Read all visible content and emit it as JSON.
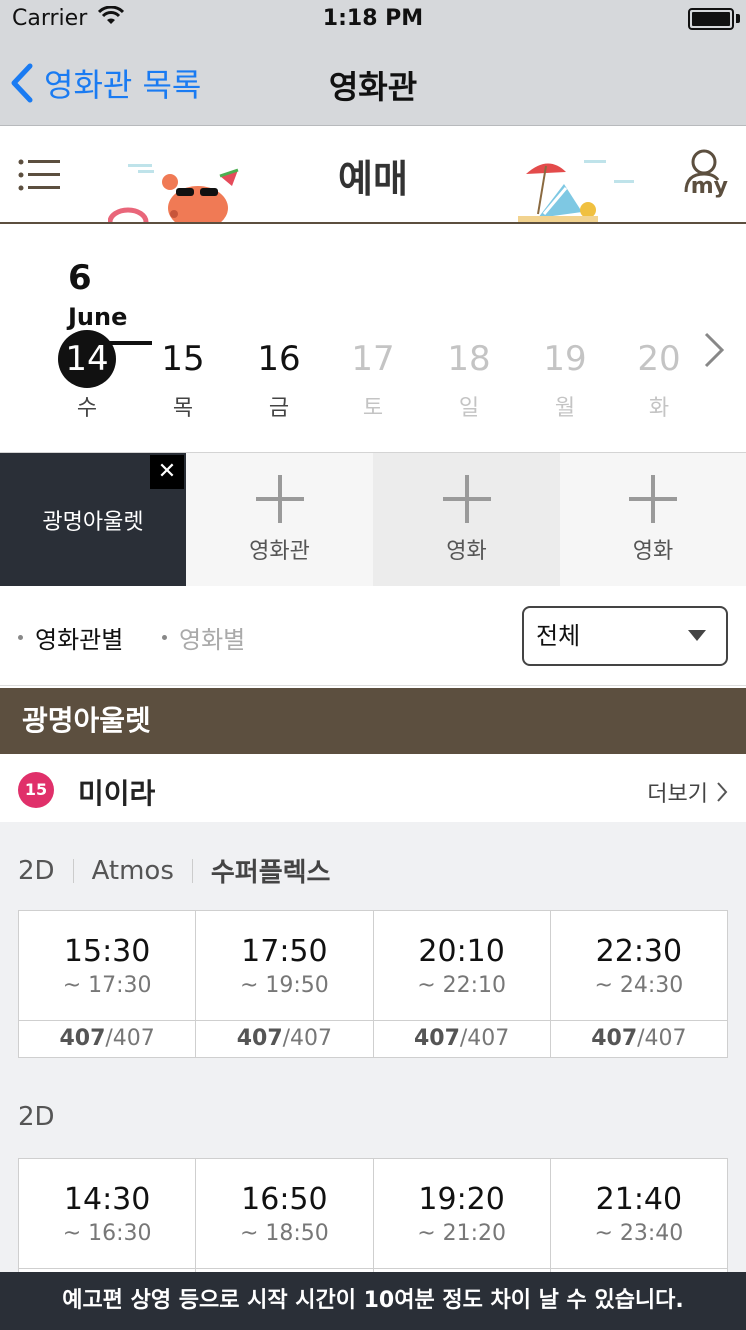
{
  "status_bar": {
    "carrier": "Carrier",
    "time": "1:18 PM"
  },
  "nav": {
    "back_label": "영화관 목록",
    "title": "영화관"
  },
  "booking_header": {
    "title": "예매",
    "my_label": "my"
  },
  "date_picker": {
    "month_day": "6",
    "month_name": "June",
    "days": [
      {
        "num": "14",
        "weekday": "수",
        "state": "selected"
      },
      {
        "num": "15",
        "weekday": "목",
        "state": "enabled"
      },
      {
        "num": "16",
        "weekday": "금",
        "state": "enabled"
      },
      {
        "num": "17",
        "weekday": "토",
        "state": "disabled"
      },
      {
        "num": "18",
        "weekday": "일",
        "state": "disabled"
      },
      {
        "num": "19",
        "weekday": "월",
        "state": "disabled"
      },
      {
        "num": "20",
        "weekday": "화",
        "state": "disabled"
      }
    ]
  },
  "tiles": {
    "selected_theater": "광명아울렛",
    "close_glyph": "✕",
    "add1": "영화관",
    "add2": "영화",
    "add3": "영화"
  },
  "filter": {
    "option_theater": "영화관별",
    "option_movie": "영화별",
    "select_value": "전체"
  },
  "theater_name": "광명아울렛",
  "movie": {
    "age_rating": "15",
    "title": "미이라",
    "more_label": "더보기"
  },
  "format_groups": [
    {
      "formats": [
        "2D",
        "Atmos",
        "수퍼플렉스"
      ],
      "showtimes": [
        {
          "start": "15:30",
          "end": "~ 17:30",
          "seats_left": "407",
          "seats_total": "/407"
        },
        {
          "start": "17:50",
          "end": "~ 19:50",
          "seats_left": "407",
          "seats_total": "/407"
        },
        {
          "start": "20:10",
          "end": "~ 22:10",
          "seats_left": "407",
          "seats_total": "/407"
        },
        {
          "start": "22:30",
          "end": "~ 24:30",
          "seats_left": "407",
          "seats_total": "/407"
        }
      ]
    },
    {
      "formats": [
        "2D"
      ],
      "showtimes": [
        {
          "start": "14:30",
          "end": "~ 16:30"
        },
        {
          "start": "16:50",
          "end": "~ 18:50"
        },
        {
          "start": "19:20",
          "end": "~ 21:20"
        },
        {
          "start": "21:40",
          "end": "~ 23:40"
        }
      ]
    }
  ],
  "toast": "예고편 상영 등으로 시작 시간이 10여분 정도 차이 날 수 있습니다.",
  "colors": {
    "header_gray": "#d6d8db",
    "ios_blue": "#1a7bf2",
    "theater_brown": "#5c4f3f",
    "selected_tile": "#2a2f37",
    "age_15_pink": "#e0306a"
  }
}
